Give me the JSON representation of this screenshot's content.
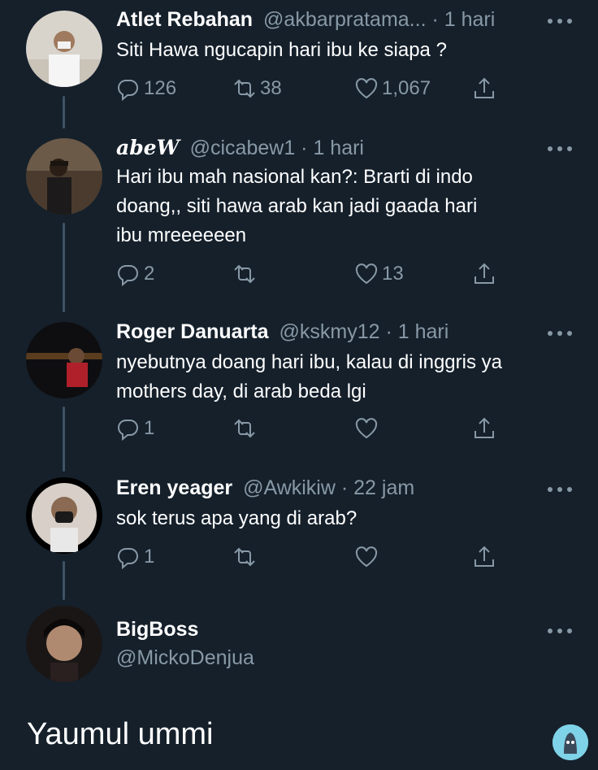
{
  "tweets": [
    {
      "name": "Atlet Rebahan",
      "handle": "@akbarpratama...",
      "sep": " · ",
      "time": "1 hari",
      "lines": [
        "Siti Hawa ngucapin hari ibu ke siapa ?"
      ],
      "replies": "126",
      "retweets": "38",
      "likes": "1,067"
    },
    {
      "name": "abeW",
      "handle": "@cicabew1",
      "sep": " · ",
      "time": "1 hari",
      "lines": [
        "Hari ibu mah nasional kan?: Brarti di indo",
        "doang,, siti hawa arab kan jadi gaada hari",
        "ibu mreeeeeen"
      ],
      "replies": "2",
      "retweets": "",
      "likes": "13"
    },
    {
      "name": "Roger Danuarta",
      "handle": "@kskmy12",
      "sep": " · ",
      "time": "1 hari",
      "lines": [
        "nyebutnya doang hari ibu, kalau di inggris ya",
        "mothers day, di arab beda lgi"
      ],
      "replies": "1",
      "retweets": "",
      "likes": ""
    },
    {
      "name": "Eren yeager",
      "handle": "@Awkikiw",
      "sep": " · ",
      "time": "22 jam",
      "lines": [
        "sok terus apa yang di arab?"
      ],
      "replies": "1",
      "retweets": "",
      "likes": ""
    }
  ],
  "main_tweet": {
    "name": "BigBoss",
    "handle": "@MickoDenjua",
    "text": "Yaumul ummi"
  },
  "colors": {
    "background": "#15202b",
    "secondary_text": "#8899a6",
    "thread_line": "#3d5466"
  },
  "icons": [
    "reply-icon",
    "retweet-icon",
    "like-icon",
    "share-icon",
    "more-icon"
  ]
}
